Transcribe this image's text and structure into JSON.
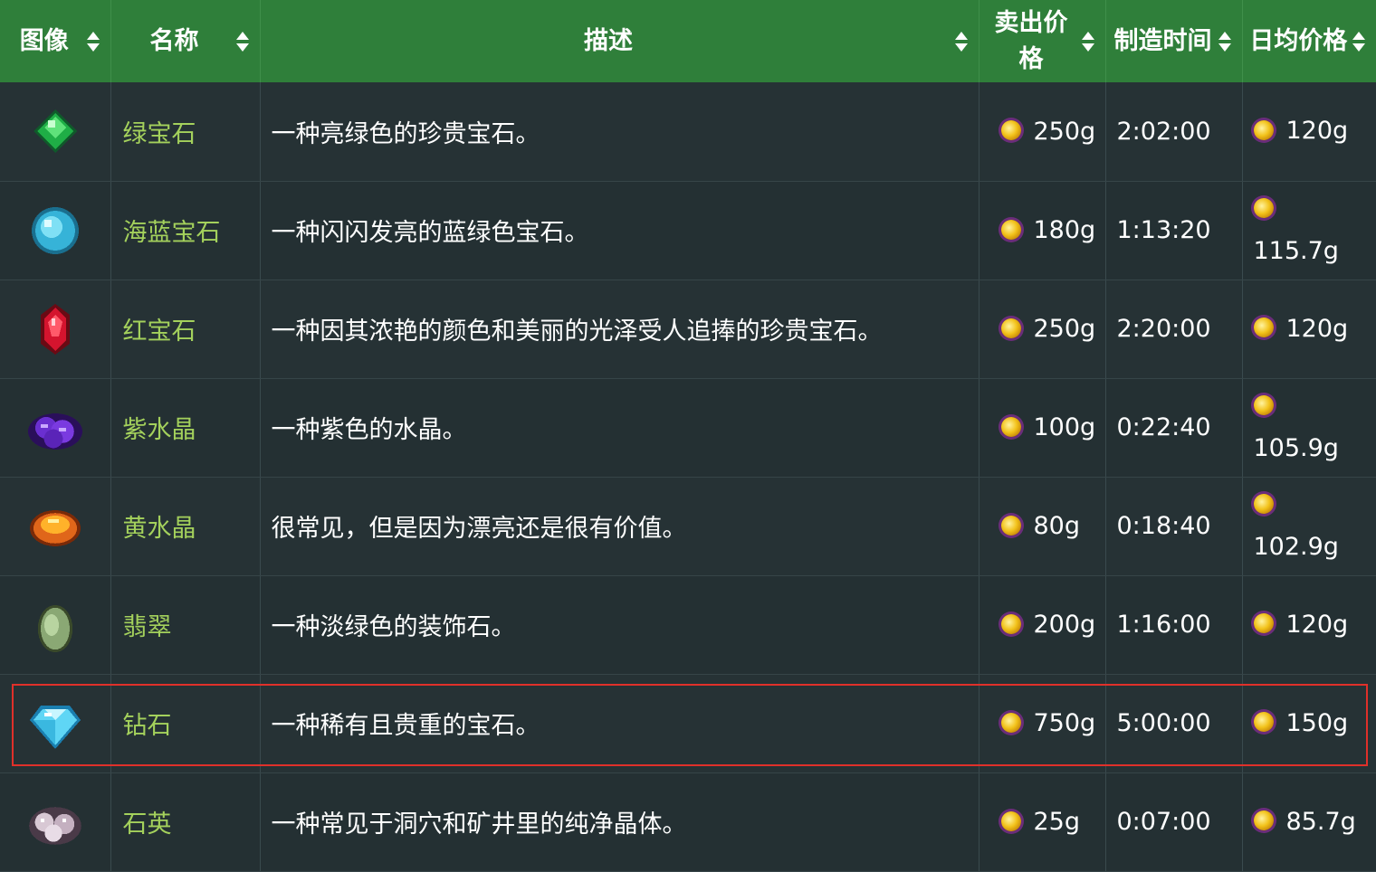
{
  "header": {
    "image": "图像",
    "name": "名称",
    "description": "描述",
    "sell_price": "卖出价格",
    "craft_time": "制造时间",
    "daily_price": "日均价格"
  },
  "rows": [
    {
      "icon": "emerald-icon",
      "name": "绿宝石",
      "description": "一种亮绿色的珍贵宝石。",
      "sell": "250g",
      "time": "2:02:00",
      "daily": "120g"
    },
    {
      "icon": "aquamarine-icon",
      "name": "海蓝宝石",
      "description": "一种闪闪发亮的蓝绿色宝石。",
      "sell": "180g",
      "time": "1:13:20",
      "daily": "115.7g"
    },
    {
      "icon": "ruby-icon",
      "name": "红宝石",
      "description": "一种因其浓艳的颜色和美丽的光泽受人追捧的珍贵宝石。",
      "sell": "250g",
      "time": "2:20:00",
      "daily": "120g"
    },
    {
      "icon": "amethyst-icon",
      "name": "紫水晶",
      "description": "一种紫色的水晶。",
      "sell": "100g",
      "time": "0:22:40",
      "daily": "105.9g"
    },
    {
      "icon": "topaz-icon",
      "name": "黄水晶",
      "description": "很常见，但是因为漂亮还是很有价值。",
      "sell": "80g",
      "time": "0:18:40",
      "daily": "102.9g"
    },
    {
      "icon": "jade-icon",
      "name": "翡翠",
      "description": "一种淡绿色的装饰石。",
      "sell": "200g",
      "time": "1:16:00",
      "daily": "120g"
    },
    {
      "icon": "diamond-icon",
      "name": "钻石",
      "description": "一种稀有且贵重的宝石。",
      "sell": "750g",
      "time": "5:00:00",
      "daily": "150g"
    },
    {
      "icon": "quartz-icon",
      "name": "石英",
      "description": "一种常见于洞穴和矿井里的纯净晶体。",
      "sell": "25g",
      "time": "0:07:00",
      "daily": "85.7g"
    }
  ],
  "colors": {
    "header_bg": "#2f7f3a",
    "name_text": "#a4d15c",
    "highlight_border": "#e0302a",
    "coin": "#f2c21a"
  },
  "highlighted_row": "钻石"
}
